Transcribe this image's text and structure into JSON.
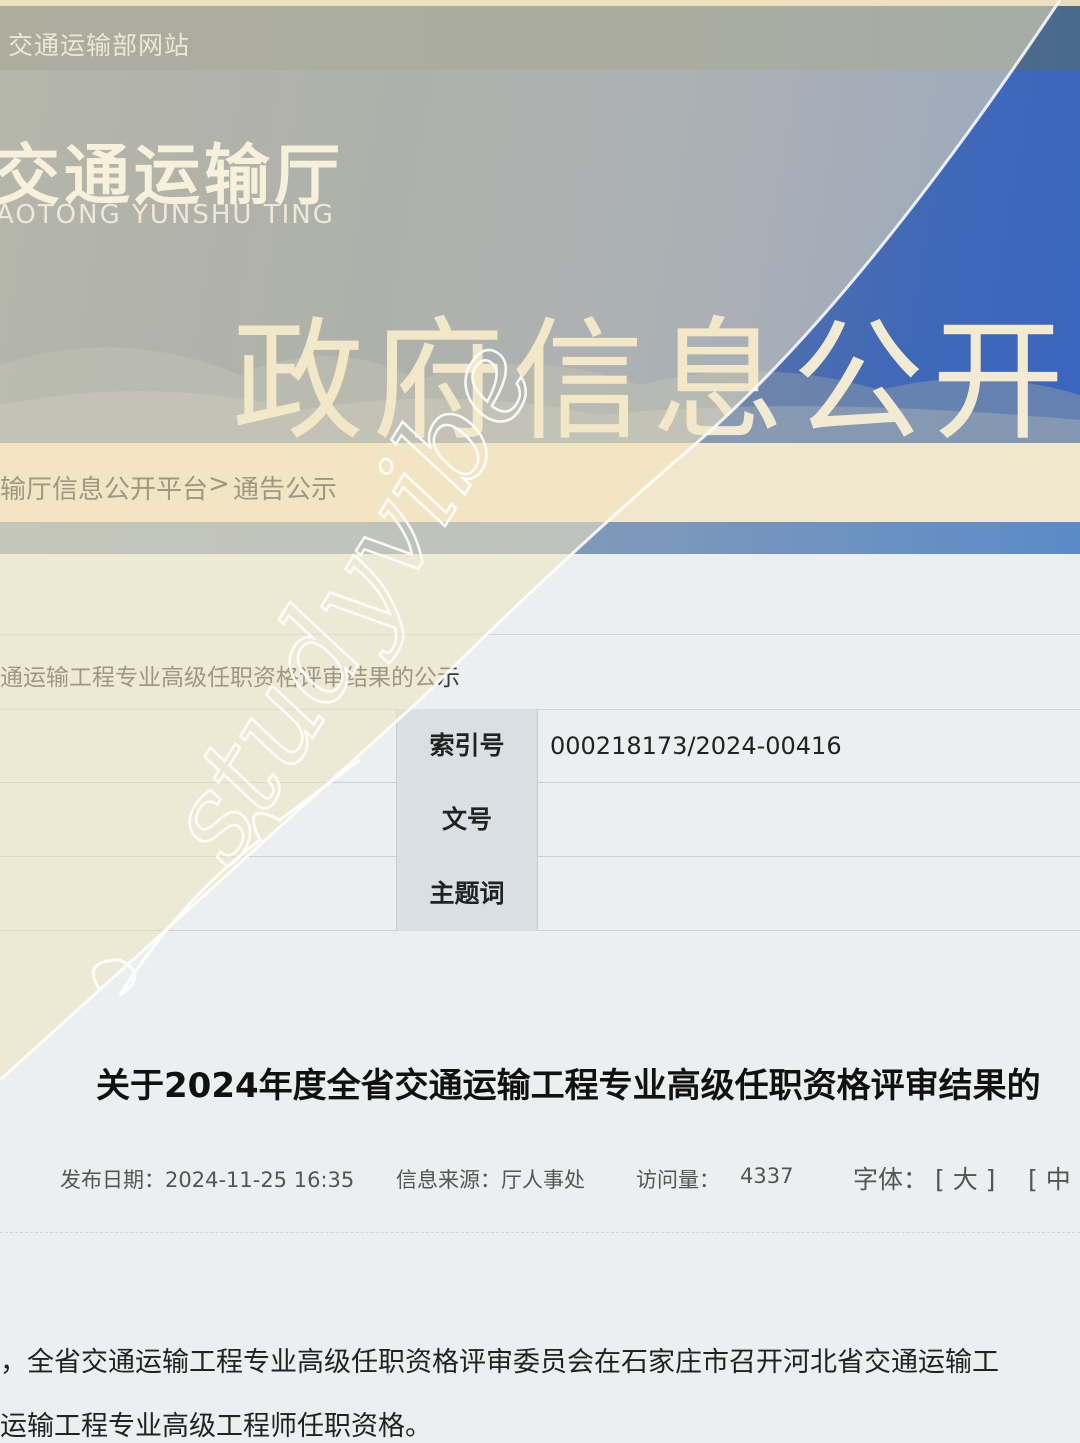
{
  "topbar": {
    "site_link": "交通运输部网站"
  },
  "banner": {
    "dept_name": "交通运输厅",
    "dept_pinyin": "AOTONG YUNSHU TING",
    "headline": "政府信息公开"
  },
  "breadcrumb": {
    "root": "输厅信息公开平台",
    "sep": ">",
    "current": "通告公示"
  },
  "list_title": "通运输工程专业高级任职资格评审结果的公示",
  "meta_rows": [
    {
      "label": "索引号",
      "value": "000218173/2024-00416"
    },
    {
      "label": "文号",
      "value": ""
    },
    {
      "label": "主题词",
      "value": ""
    }
  ],
  "article": {
    "title": "关于2024年度全省交通运输工程专业高级任职资格评审结果的",
    "publish_date": "发布日期：2024-11-25 16:35",
    "source": "信息来源：厅人事处",
    "visits_label": "访问量：",
    "visits": "4337",
    "font_label": "字体：",
    "font_large": "[ 大 ]",
    "font_medium": "[ 中 ]",
    "body_line1": "，全省交通运输工程专业高级任职资格评审委员会在石家庄市召开河北省交通运输工",
    "body_line2": "运输工程专业高级工程师任职资格。"
  },
  "watermark": {
    "text": "studyvibe"
  },
  "colors": {
    "cream": "#f1e7cd",
    "banner_blue": "#3f68b8",
    "page_bg": "#eceff0"
  }
}
